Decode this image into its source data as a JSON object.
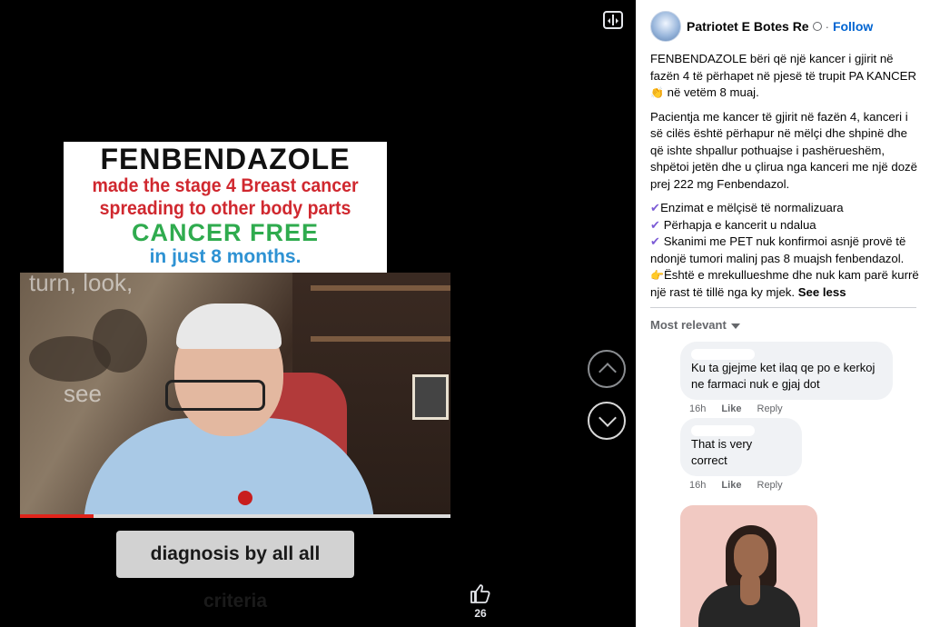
{
  "media": {
    "headline_title": "FENBENDAZOLE",
    "headline_line2": "made the stage 4 Breast cancer",
    "headline_line3": "spreading to other body parts",
    "headline_line4": "CANCER FREE",
    "headline_line5": "in just 8 months.",
    "video_overlay_1": "turn, look,",
    "video_overlay_2": "see",
    "caption": "diagnosis by all all criteria",
    "video_progress": 0.17,
    "like_count": "26",
    "icons": [
      "expand-icon",
      "chevron-up-icon",
      "chevron-down-icon",
      "thumbs-up-icon"
    ]
  },
  "panel": {
    "page_name": "Patriotet E Botes Re",
    "separator": "·",
    "follow_label": "Follow",
    "post_paragraph_1": "FENBENDAZOLE bëri që një kancer i gjirit në fazën 4 të përhapet në pjesë të trupit PA KANCER",
    "post_paragraph_1_end": "në vetëm 8 muaj.",
    "post_paragraph_2": "Pacientja me kancer të gjirit në fazën 4, kanceri i së cilës është përhapur në mëlçi dhe shpinë dhe që ishte shpallur pothuajse i pashërueshëm, shpëtoi jetën dhe u çlirua nga kanceri me një dozë prej 222 mg Fenbendazol.",
    "check_1": "Enzimat e mëlçisë të normalizuara",
    "check_2": "Përhapja e kancerit u ndalua",
    "check_3": "Skanimi me PET nuk konfirmoi asnjë provë të ndonjë tumori malinj pas 8 muajsh fenbendazol.",
    "point_1": "Është e mrekullueshme dhe nuk kam parë kurrë një rast të tillë nga ky mjek.",
    "see_less": "See less",
    "sort_label": "Most relevant",
    "comments": [
      {
        "text": "Ku ta gjejme ket ilaq qe po e kerkoj ne farmaci nuk e gjaj dot",
        "time": "16h",
        "like": "Like",
        "reply": "Reply"
      },
      {
        "text": "That is very correct",
        "time": "16h",
        "like": "Like",
        "reply": "Reply"
      }
    ],
    "emoji": {
      "clap": "👏",
      "check": "✔",
      "point": "👉"
    }
  }
}
